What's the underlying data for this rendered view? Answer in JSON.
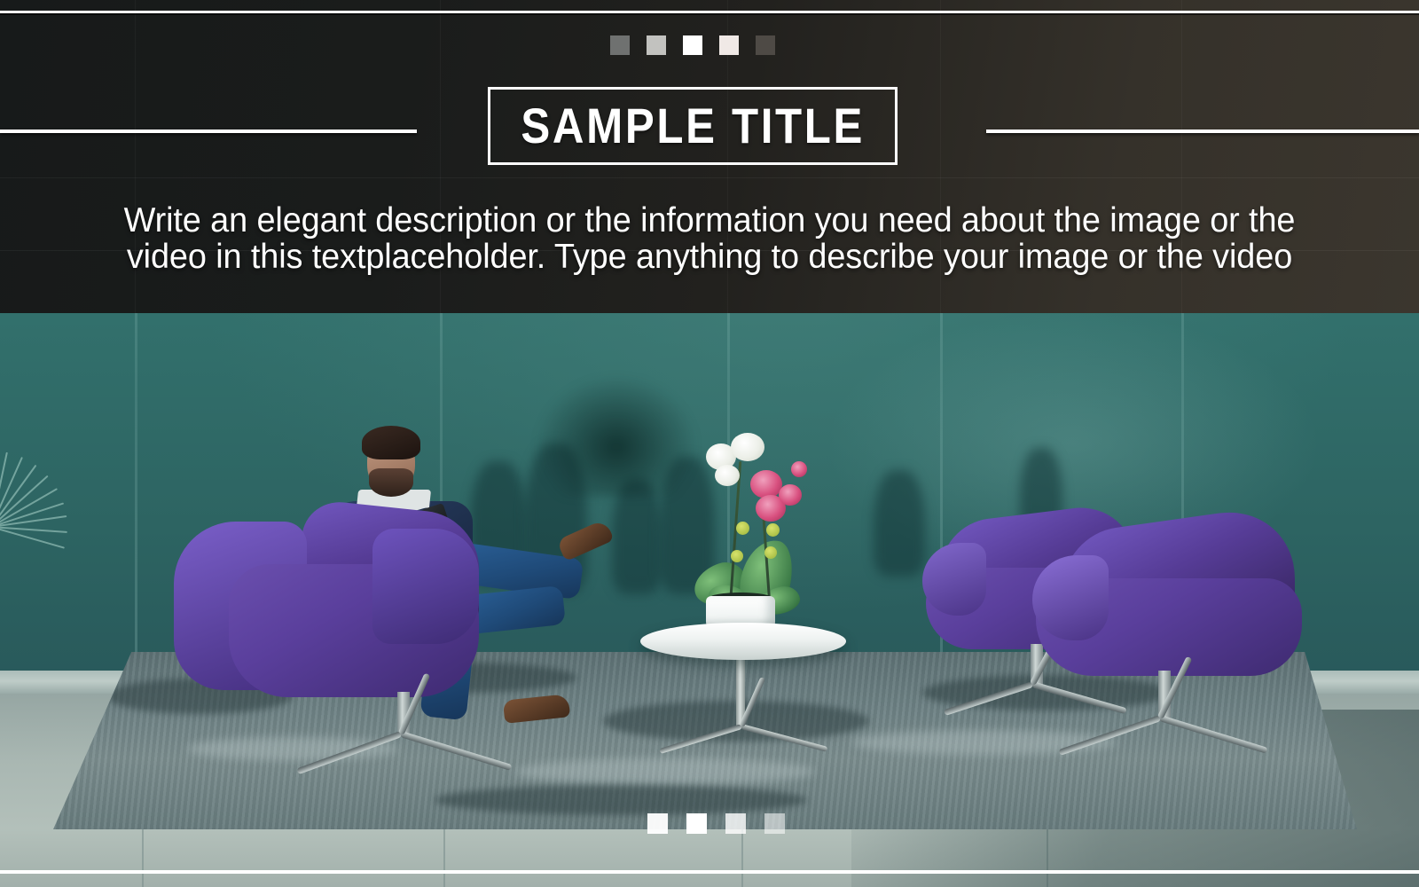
{
  "slide": {
    "title": "SAMPLE TITLE",
    "description": "Write an elegant description or the information you need about the image or the video in this textplaceholder. Type anything to describe your image or the video",
    "colors": {
      "header_dark": "#1a1c1b",
      "header_warm": "#3b362e",
      "accent_white": "#ffffff",
      "chair_purple": "#5a3f9c",
      "wall_teal": "#32706c",
      "floor_gray": "#a9b7b2"
    },
    "top_markers": [
      {
        "name": "marker-1",
        "color": "#6f7170",
        "opacity": 1
      },
      {
        "name": "marker-2",
        "color": "#c2c2bf",
        "opacity": 1
      },
      {
        "name": "marker-3",
        "color": "#ffffff",
        "opacity": 1
      },
      {
        "name": "marker-4",
        "color": "#f0e9e6",
        "opacity": 1
      },
      {
        "name": "marker-5",
        "color": "#4e4a45",
        "opacity": 1
      }
    ],
    "bottom_markers": [
      {
        "name": "marker-1",
        "opacity": 0.95
      },
      {
        "name": "marker-2",
        "opacity": 1
      },
      {
        "name": "marker-3",
        "opacity": 0.8
      },
      {
        "name": "marker-4",
        "opacity": 0.55
      }
    ],
    "photo": {
      "alt": "Man in blue suit seated in a purple armchair using a smartphone in a modern lounge with teal glass wall, white oval coffee table with an orchid, and two purple armchairs opposite",
      "subjects": [
        "seated-man",
        "purple-armchair-left",
        "purple-armchair-right-far",
        "purple-armchair-right-near",
        "white-oval-coffee-table",
        "orchid-plant",
        "gray-area-rug",
        "teal-glass-wall"
      ]
    }
  }
}
